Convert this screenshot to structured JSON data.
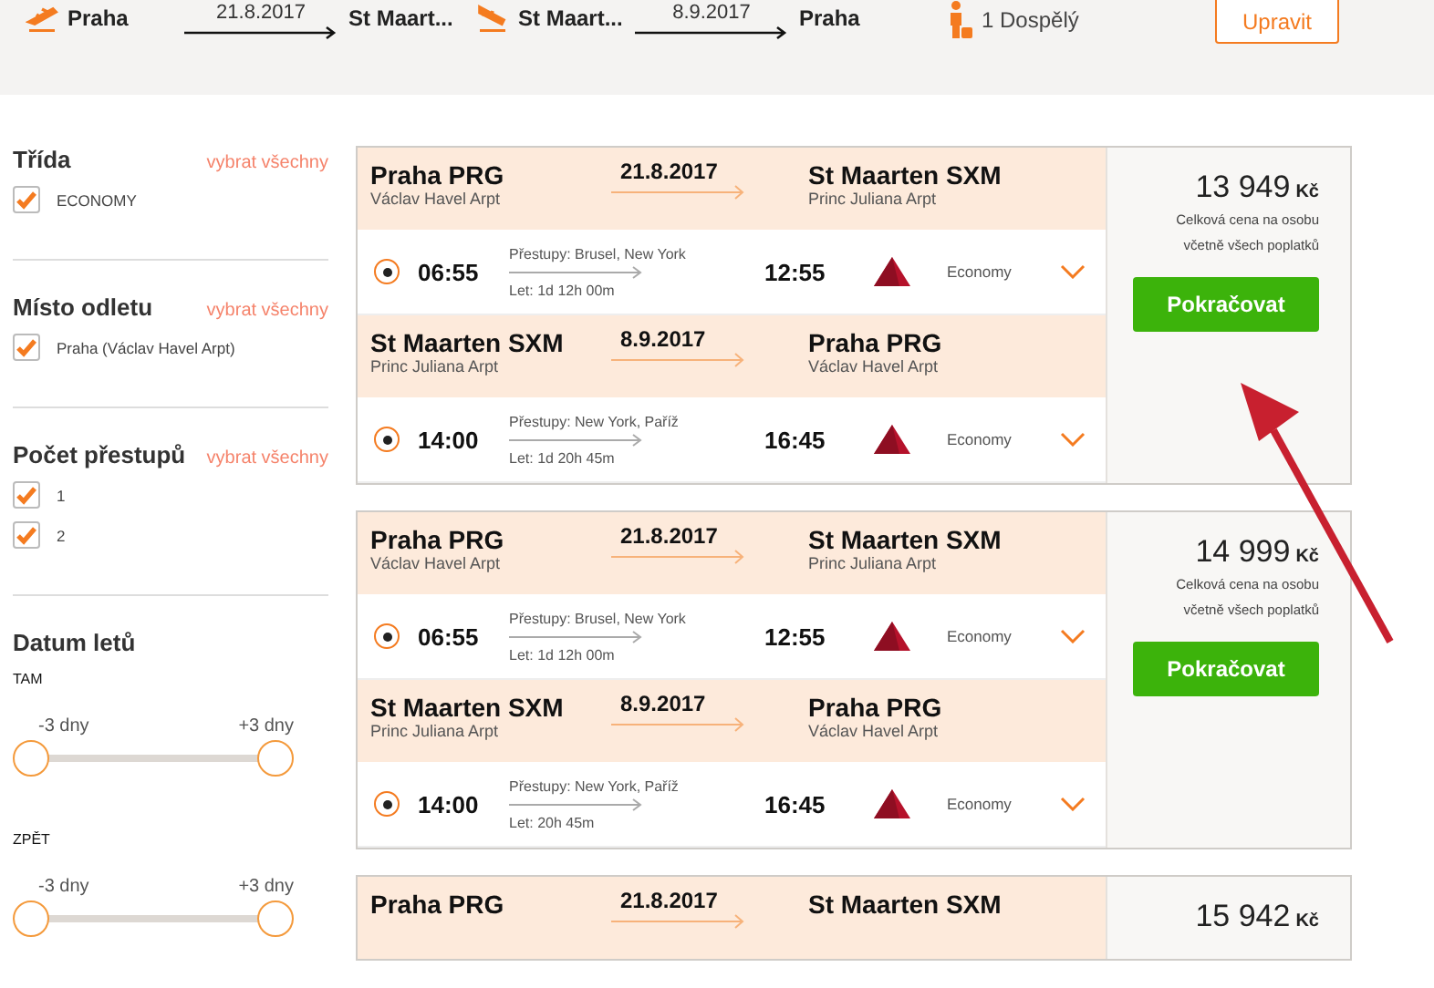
{
  "trip_bar": {
    "legs": [
      {
        "kind": "departure",
        "from": "Praha",
        "date": "21.8.2017",
        "to": "St Maart..."
      },
      {
        "kind": "arrival",
        "from": "St Maart...",
        "date": "8.9.2017",
        "to": "Praha"
      }
    ],
    "passengers": "1 Dospělý",
    "edit_button": "Upravit"
  },
  "filters": [
    {
      "title": "Třída",
      "select_all": "vybrat všechny",
      "options": [
        {
          "label": "ECONOMY",
          "checked": true
        }
      ]
    },
    {
      "title": "Místo odletu",
      "select_all": "vybrat všechny",
      "options": [
        {
          "label": "Praha (Václav Havel Arpt)",
          "checked": true
        }
      ]
    },
    {
      "title": "Počet přestupů",
      "select_all": "vybrat všechny",
      "options": [
        {
          "label": "1",
          "checked": true
        },
        {
          "label": "2",
          "checked": true
        }
      ]
    }
  ],
  "dates": {
    "title": "Datum letů",
    "ranges": [
      {
        "label": "TAM",
        "min": "-3 dny",
        "max": "+3 dny",
        "handles": [
          {
            "level": 0
          },
          {
            "level": 1
          }
        ]
      },
      {
        "label": "ZPĚT",
        "min": "-3 dny",
        "max": "+3 dny",
        "handles": [
          {
            "level": 0
          },
          {
            "level": 1
          }
        ]
      }
    ]
  },
  "results": [
    {
      "legs": [
        {
          "from": {
            "name": "Praha PRG",
            "airport": "Václav Havel Arpt"
          },
          "date": "21.8.2017",
          "to": {
            "name": "St Maarten SXM",
            "airport": "Princ Juliana Arpt"
          },
          "flight": {
            "selected": true,
            "depart": "06:55",
            "stops": "Přestupy: Brusel, New York",
            "duration": "Let: 1d 12h 00m",
            "arrive": "12:55",
            "cabin": "Economy"
          }
        },
        {
          "from": {
            "name": "St Maarten SXM",
            "airport": "Princ Juliana Arpt"
          },
          "date": "8.9.2017",
          "to": {
            "name": "Praha PRG",
            "airport": "Václav Havel Arpt"
          },
          "flight": {
            "selected": true,
            "depart": "14:00",
            "stops": "Přestupy: New York, Paříž",
            "duration": "Let: 1d 20h 45m",
            "arrive": "16:45",
            "cabin": "Economy"
          }
        }
      ],
      "price": "13 949",
      "currency": "Kč",
      "price_note": "Celková cena na osobu včetně všech poplatků",
      "button": "Pokračovat"
    },
    {
      "legs": [
        {
          "from": {
            "name": "Praha PRG",
            "airport": "Václav Havel Arpt"
          },
          "date": "21.8.2017",
          "to": {
            "name": "St Maarten SXM",
            "airport": "Princ Juliana Arpt"
          },
          "flight": {
            "selected": true,
            "depart": "06:55",
            "stops": "Přestupy: Brusel, New York",
            "duration": "Let: 1d 12h 00m",
            "arrive": "12:55",
            "cabin": "Economy"
          }
        },
        {
          "from": {
            "name": "St Maarten SXM",
            "airport": "Princ Juliana Arpt"
          },
          "date": "8.9.2017",
          "to": {
            "name": "Praha PRG",
            "airport": "Václav Havel Arpt"
          },
          "flight": {
            "selected": true,
            "depart": "14:00",
            "stops": "Přestupy: New York, Paříž",
            "duration": "Let: 20h 45m",
            "arrive": "16:45",
            "cabin": "Economy"
          }
        }
      ],
      "price": "14 999",
      "currency": "Kč",
      "price_note": "Celková cena na osobu včetně všech poplatků",
      "button": "Pokračovat"
    },
    {
      "legs": [
        {
          "from": {
            "name": "Praha PRG"
          },
          "date": "21.8.2017",
          "to": {
            "name": "St Maarten SXM"
          }
        }
      ],
      "price": "15 942",
      "currency": "Kč"
    }
  ]
}
